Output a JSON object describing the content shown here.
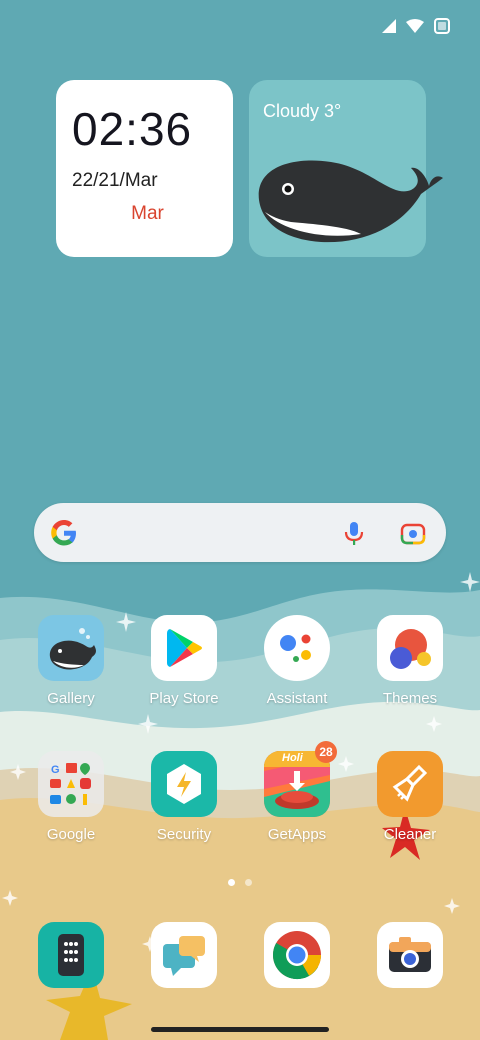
{
  "status_bar": {
    "icons": [
      "signal-icon",
      "wifi-icon",
      "battery-icon"
    ]
  },
  "clock_widget": {
    "time": "02:36",
    "date": "22/21/Mar",
    "lunar": "Mar"
  },
  "weather_widget": {
    "condition": "Cloudy  3°"
  },
  "search_bar": {
    "icons": [
      "google-g-icon",
      "microphone-icon",
      "lens-camera-icon"
    ]
  },
  "apps": [
    {
      "label": "Gallery",
      "icon": "whale-gallery-icon"
    },
    {
      "label": "Play Store",
      "icon": "play-store-icon"
    },
    {
      "label": "Assistant",
      "icon": "assistant-icon"
    },
    {
      "label": "Themes",
      "icon": "themes-icon"
    },
    {
      "label": "Google",
      "icon": "google-folder-icon"
    },
    {
      "label": "Security",
      "icon": "security-bolt-icon"
    },
    {
      "label": "GetApps",
      "icon": "getapps-icon",
      "badge": "28",
      "banner": "Holi"
    },
    {
      "label": "Cleaner",
      "icon": "cleaner-broom-icon"
    }
  ],
  "page_indicator": {
    "pages": 2,
    "active": 1
  },
  "dock": [
    {
      "icon": "app-drawer-icon"
    },
    {
      "icon": "messages-icon"
    },
    {
      "icon": "chrome-icon"
    },
    {
      "icon": "camera-icon"
    }
  ],
  "colors": {
    "sky": "#5fa9b3",
    "sand": "#e8c98a",
    "accent_red": "#d9442f",
    "badge": "#f26b3a"
  }
}
